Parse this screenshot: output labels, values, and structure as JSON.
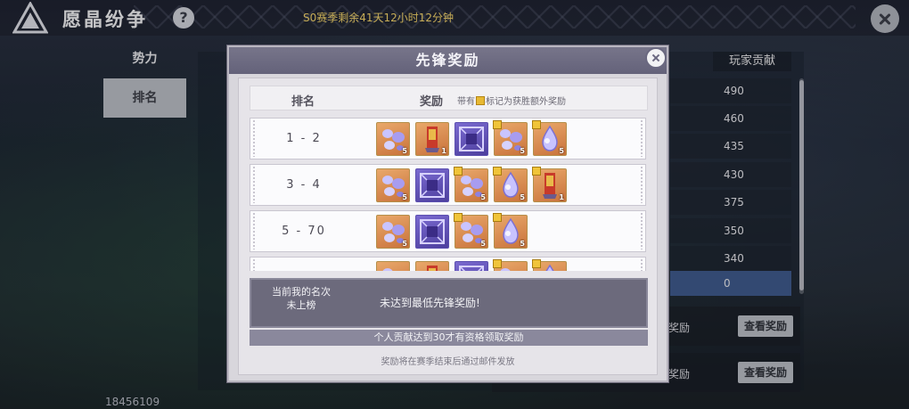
{
  "header": {
    "title": "愿晶纷争",
    "help_label": "?",
    "season_timer": "S0赛季剩余41天12小时12分钟"
  },
  "nav": {
    "items": [
      {
        "label": "势力"
      },
      {
        "label": "排名"
      }
    ],
    "active": "排名"
  },
  "background": {
    "contribution_header": "玩家贡献",
    "contributions": [
      "490",
      "460",
      "435",
      "430",
      "375",
      "350",
      "340"
    ],
    "my_contribution": "0",
    "reward_rows": [
      {
        "label": "奖励",
        "button": "查看奖励"
      },
      {
        "label": "奖励",
        "button": "查看奖励"
      }
    ],
    "player_id": "18456109"
  },
  "modal": {
    "title": "先锋奖励",
    "columns": {
      "rank": "排名",
      "reward": "奖励",
      "note_prefix": "带有",
      "note_suffix": "标记为获胜额外奖励"
    },
    "rows": [
      {
        "rank": "1 - 2",
        "items": [
          {
            "kind": "crystal-pile",
            "color": "orange",
            "qty": "5",
            "bonus": false
          },
          {
            "kind": "banner",
            "color": "orange",
            "qty": "1",
            "bonus": false
          },
          {
            "kind": "frame",
            "color": "purple",
            "qty": "",
            "bonus": false
          },
          {
            "kind": "crystal-pile",
            "color": "orange",
            "qty": "5",
            "bonus": true
          },
          {
            "kind": "crystal-drop",
            "color": "orange",
            "qty": "5",
            "bonus": true
          }
        ]
      },
      {
        "rank": "3 - 4",
        "items": [
          {
            "kind": "crystal-pile",
            "color": "orange",
            "qty": "5",
            "bonus": false
          },
          {
            "kind": "frame",
            "color": "purple",
            "qty": "",
            "bonus": false
          },
          {
            "kind": "crystal-pile",
            "color": "orange",
            "qty": "5",
            "bonus": true
          },
          {
            "kind": "crystal-drop",
            "color": "orange",
            "qty": "5",
            "bonus": true
          },
          {
            "kind": "banner",
            "color": "orange",
            "qty": "1",
            "bonus": true
          }
        ]
      },
      {
        "rank": "5 - 70",
        "items": [
          {
            "kind": "crystal-pile",
            "color": "orange",
            "qty": "5",
            "bonus": false
          },
          {
            "kind": "frame",
            "color": "purple",
            "qty": "",
            "bonus": false
          },
          {
            "kind": "crystal-pile",
            "color": "orange",
            "qty": "5",
            "bonus": true
          },
          {
            "kind": "crystal-drop",
            "color": "orange",
            "qty": "5",
            "bonus": true
          }
        ]
      },
      {
        "rank": "",
        "items": [
          {
            "kind": "crystal-pile",
            "color": "orange",
            "qty": "",
            "bonus": false
          },
          {
            "kind": "banner",
            "color": "orange",
            "qty": "",
            "bonus": false
          },
          {
            "kind": "frame",
            "color": "purple",
            "qty": "",
            "bonus": false
          },
          {
            "kind": "crystal-pile",
            "color": "orange",
            "qty": "",
            "bonus": true
          },
          {
            "kind": "crystal-drop",
            "color": "orange",
            "qty": "",
            "bonus": true
          }
        ]
      }
    ],
    "my_rank_label_line1": "当前我的名次",
    "my_rank_label_line2": "未上榜",
    "my_rank_status": "未达到最低先锋奖励!",
    "requirement": "个人贡献达到30才有资格领取奖励",
    "mail_note": "奖励将在赛季结束后通过邮件发放"
  },
  "colors": {
    "timer": "#f3d36a",
    "modal_header": "#6e6c82",
    "active_nav": "#b9bcc4",
    "my_row_highlight": "#3f5a8c",
    "bonus_mark": "#e7b934"
  }
}
